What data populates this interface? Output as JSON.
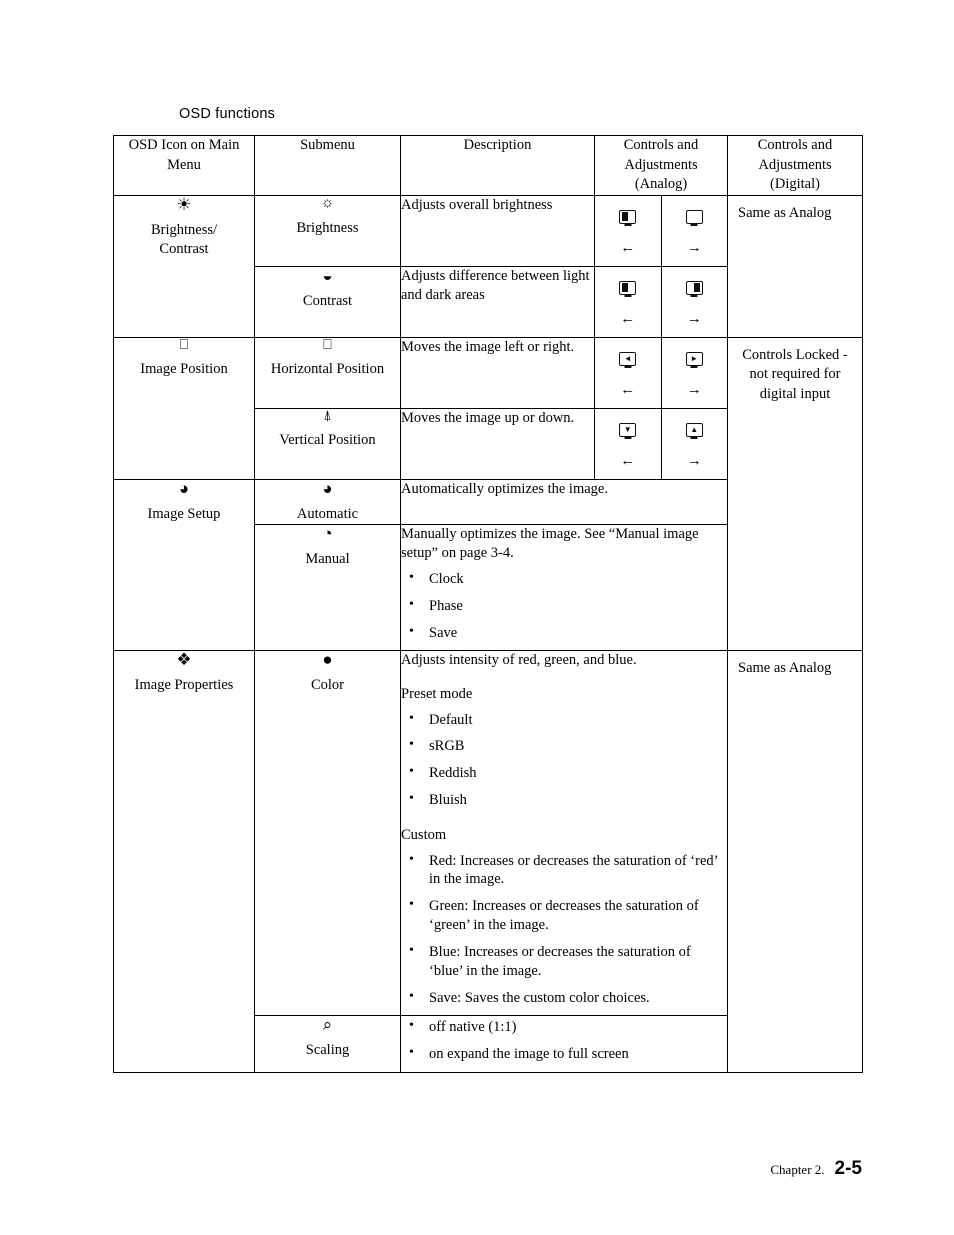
{
  "page": {
    "heading": "OSD functions",
    "footer_chapter": "Chapter 2.",
    "footer_page": "2-5"
  },
  "table": {
    "headers": {
      "col1": "OSD Icon on Main\nMenu",
      "col1_line1": "OSD Icon on Main",
      "col1_line2": "Menu",
      "col2": "Submenu",
      "col3": "Description",
      "col4_line1": "Controls and",
      "col4_line2": "Adjustments",
      "col4_line3": "(Analog)",
      "col5_line1": "Controls and",
      "col5_line2": "Adjustments",
      "col5_line3": "(Digital)"
    },
    "groups": [
      {
        "icon_name": "brightness-contrast-icon",
        "label_line1": "Brightness/",
        "label_line2": "Contrast",
        "digital": "Same as Analog",
        "rows": [
          {
            "sub_icon": "brightness-icon",
            "sub_label": "Brightness",
            "description": "Adjusts overall brightness",
            "analog_left_arrow": "←",
            "analog_right_arrow": "→"
          },
          {
            "sub_icon": "contrast-icon",
            "sub_label": "Contrast",
            "description": "Adjusts difference between light and dark areas",
            "analog_left_arrow": "←",
            "analog_right_arrow": "→"
          }
        ]
      },
      {
        "icon_name": "image-position-icon",
        "label_line1": "Image Position",
        "label_line2": "",
        "digital_line1": "Controls Locked -",
        "digital_line2": "not required  for",
        "digital_line3": "digital input",
        "rows": [
          {
            "sub_icon": "horizontal-position-icon",
            "sub_label": "Horizontal Position",
            "description": "Moves the image left or right.",
            "analog_left_arrow": "←",
            "analog_right_arrow": "→"
          },
          {
            "sub_icon": "vertical-position-icon",
            "sub_label": "Vertical Position",
            "description": "Moves the image up or down.",
            "analog_left_arrow": "←",
            "analog_right_arrow": "→"
          }
        ]
      },
      {
        "icon_name": "image-setup-icon",
        "label_line1": "Image Setup",
        "rows": [
          {
            "sub_icon": "automatic-icon",
            "sub_label": "Automatic",
            "description": "Automatically optimizes the image."
          },
          {
            "sub_icon": "manual-icon",
            "sub_label": "Manual",
            "description": "Manually optimizes the image. See “Manual image setup” on page 3-4.",
            "bullets": [
              "Clock",
              "Phase",
              "Save"
            ]
          }
        ]
      },
      {
        "icon_name": "image-properties-icon",
        "label_line1": "Image Properties",
        "digital": "Same as Analog",
        "rows": [
          {
            "sub_icon": "color-icon",
            "sub_label": "Color",
            "description": "Adjusts intensity of red, green, and blue.",
            "preset_heading": "Preset mode",
            "preset_bullets": [
              "Default",
              "sRGB",
              "Reddish",
              "Bluish"
            ],
            "custom_heading": "Custom",
            "custom_bullets": [
              "Red: Increases or decreases the saturation of ‘red’ in the image.",
              "Green: Increases or decreases the saturation of ‘green’ in the image.",
              "Blue: Increases or decreases the saturation of ‘blue’ in the image.",
              "Save: Saves the custom color choices."
            ]
          },
          {
            "sub_icon": "scaling-icon",
            "sub_label": "Scaling",
            "bullets": [
              "off native (1:1)",
              "on expand the image to full screen"
            ]
          }
        ]
      }
    ]
  }
}
